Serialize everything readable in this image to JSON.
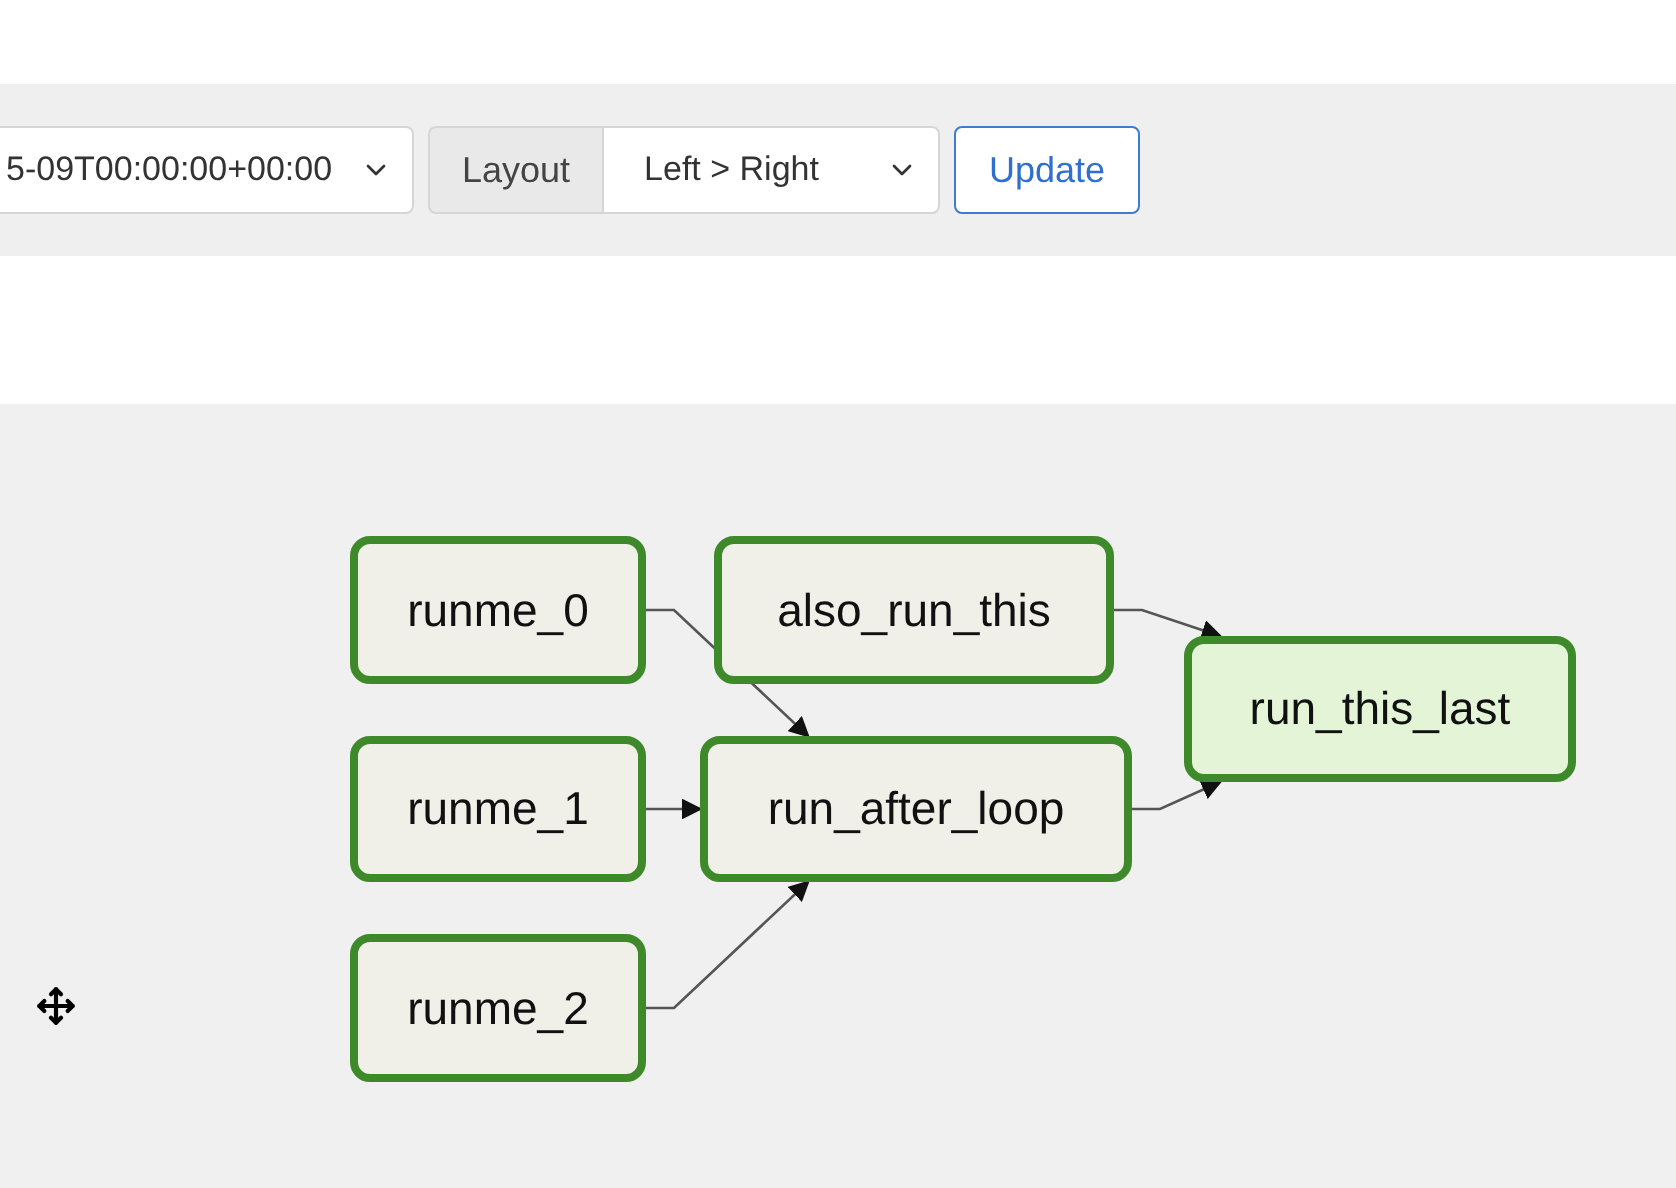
{
  "toolbar": {
    "run_select": {
      "value": "5-09T00:00:00+00:00"
    },
    "layout_label": "Layout",
    "layout_select": {
      "value": "Left > Right"
    },
    "update_button": "Update"
  },
  "graph": {
    "nodes": [
      {
        "label": "runme_0",
        "highlighted": false
      },
      {
        "label": "also_run_this",
        "highlighted": false
      },
      {
        "label": "runme_1",
        "highlighted": false
      },
      {
        "label": "run_after_loop",
        "highlighted": false
      },
      {
        "label": "runme_2",
        "highlighted": false
      },
      {
        "label": "run_this_last",
        "highlighted": true
      }
    ]
  }
}
